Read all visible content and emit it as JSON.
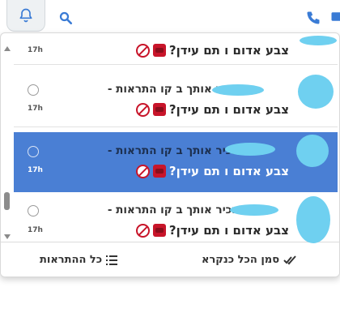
{
  "topbar": {
    "icons": [
      "bell-icon",
      "search-icon",
      "phone-icon",
      "chat-icon"
    ]
  },
  "colors": {
    "accent": "#4a7fd4",
    "icon_blue": "#3a7bd5"
  },
  "notifications": [
    {
      "text_line1": "",
      "text_line2": "צבע אדום ו תם עידן?",
      "time": "17h",
      "selected": false
    },
    {
      "text_line1": "הזכיר אותך ב קו התראות -",
      "text_line2": "צבע אדום ו תם עידן?",
      "time": "17h",
      "selected": false
    },
    {
      "text_line1": "הזכיר אותך ב קו התראות -",
      "text_line2": "צבע אדום ו תם עידן?",
      "time": "17h",
      "selected": true
    },
    {
      "text_line1": "הזכיר אותך ב קו התראות -",
      "text_line2": "צבע אדום ו תם עידן?",
      "time": "17h",
      "selected": false
    }
  ],
  "footer": {
    "mark_all_read": "סמן הכל כנקרא",
    "all_notifications": "כל ההתראות"
  }
}
